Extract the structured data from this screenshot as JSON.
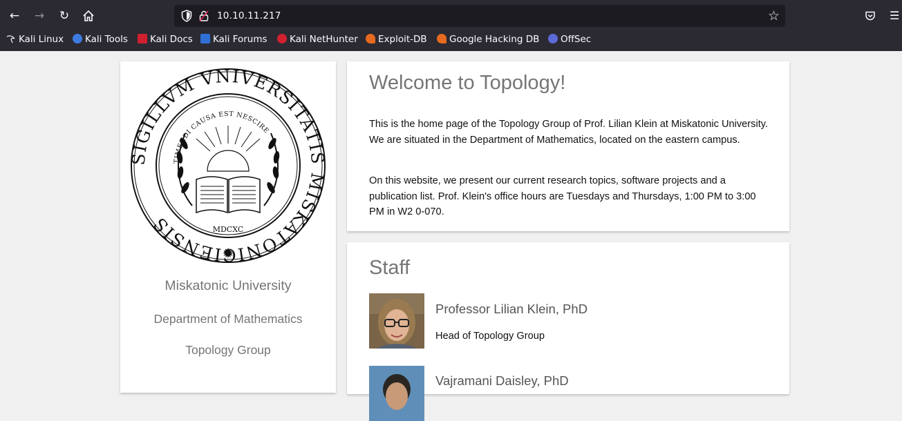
{
  "browser": {
    "url": "10.10.11.217",
    "bookmarks": [
      {
        "label": "Kali Linux",
        "icon": "kali-dragon-icon",
        "color": "#ffffff"
      },
      {
        "label": "Kali Tools",
        "icon": "kali-tools-icon",
        "color": "#3d7be0"
      },
      {
        "label": "Kali Docs",
        "icon": "kali-docs-icon",
        "color": "#d0202f"
      },
      {
        "label": "Kali Forums",
        "icon": "kali-forums-icon",
        "color": "#2f6fd6"
      },
      {
        "label": "Kali NetHunter",
        "icon": "kali-nethunter-icon",
        "color": "#d0202f"
      },
      {
        "label": "Exploit-DB",
        "icon": "exploit-db-icon",
        "color": "#e66a1f"
      },
      {
        "label": "Google Hacking DB",
        "icon": "ghdb-icon",
        "color": "#e66a1f"
      },
      {
        "label": "OffSec",
        "icon": "offsec-icon",
        "color": "#5b6ad6"
      }
    ]
  },
  "sidebar": {
    "seal": {
      "outer_text": "SIGILLVM VNIVERSITATIS MISKATONICIENSIS",
      "motto": "TIMENDI CAUSA EST NESCIRE",
      "year": "MDCXC"
    },
    "university": "Miskatonic University",
    "department": "Department of Mathematics",
    "group": "Topology Group"
  },
  "welcome": {
    "title": "Welcome to Topology!",
    "paragraph1": "This is the home page of the Topology Group of Prof. Lilian Klein at Miskatonic University. We are situated in the Department of Mathematics, located on the eastern campus.",
    "paragraph2": "On this website, we present our current research topics, software projects and a publication list. Prof. Klein's office hours are Tuesdays and Thursdays, 1:00 PM to 3:00 PM in W2 0-070."
  },
  "staff": {
    "title": "Staff",
    "members": [
      {
        "name": "Professor Lilian Klein, PhD",
        "role": "Head of Topology Group"
      },
      {
        "name": "Vajramani Daisley, PhD",
        "role": ""
      }
    ]
  }
}
